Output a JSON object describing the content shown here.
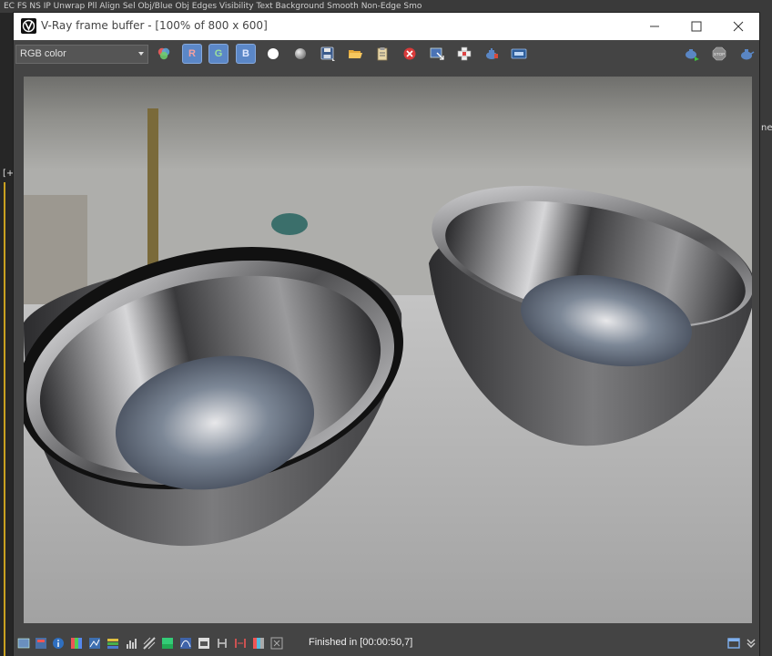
{
  "window": {
    "title": "V-Ray frame buffer - [100% of 800 x 600]"
  },
  "background_app": {
    "top_strip": "EC          FS          NS          IP          Unwrap      Pll Align    Sel Obj/Blue    Obj Edges      Visibility     Text Background     Smooth     Non-Edge      Smo",
    "left_label": "[+",
    "right_label": "net"
  },
  "toolbar": {
    "channel_select": "RGB color",
    "red_label": "R",
    "green_label": "G",
    "blue_label": "B"
  },
  "render": {
    "description_colors": {
      "sky": "#8a8a86",
      "floor": "#b3b3b3",
      "metal_dark": "#2a2a2c",
      "metal_light": "#d8d8da"
    }
  },
  "statusbar": {
    "status": "Finished in [00:00:50,7]"
  }
}
